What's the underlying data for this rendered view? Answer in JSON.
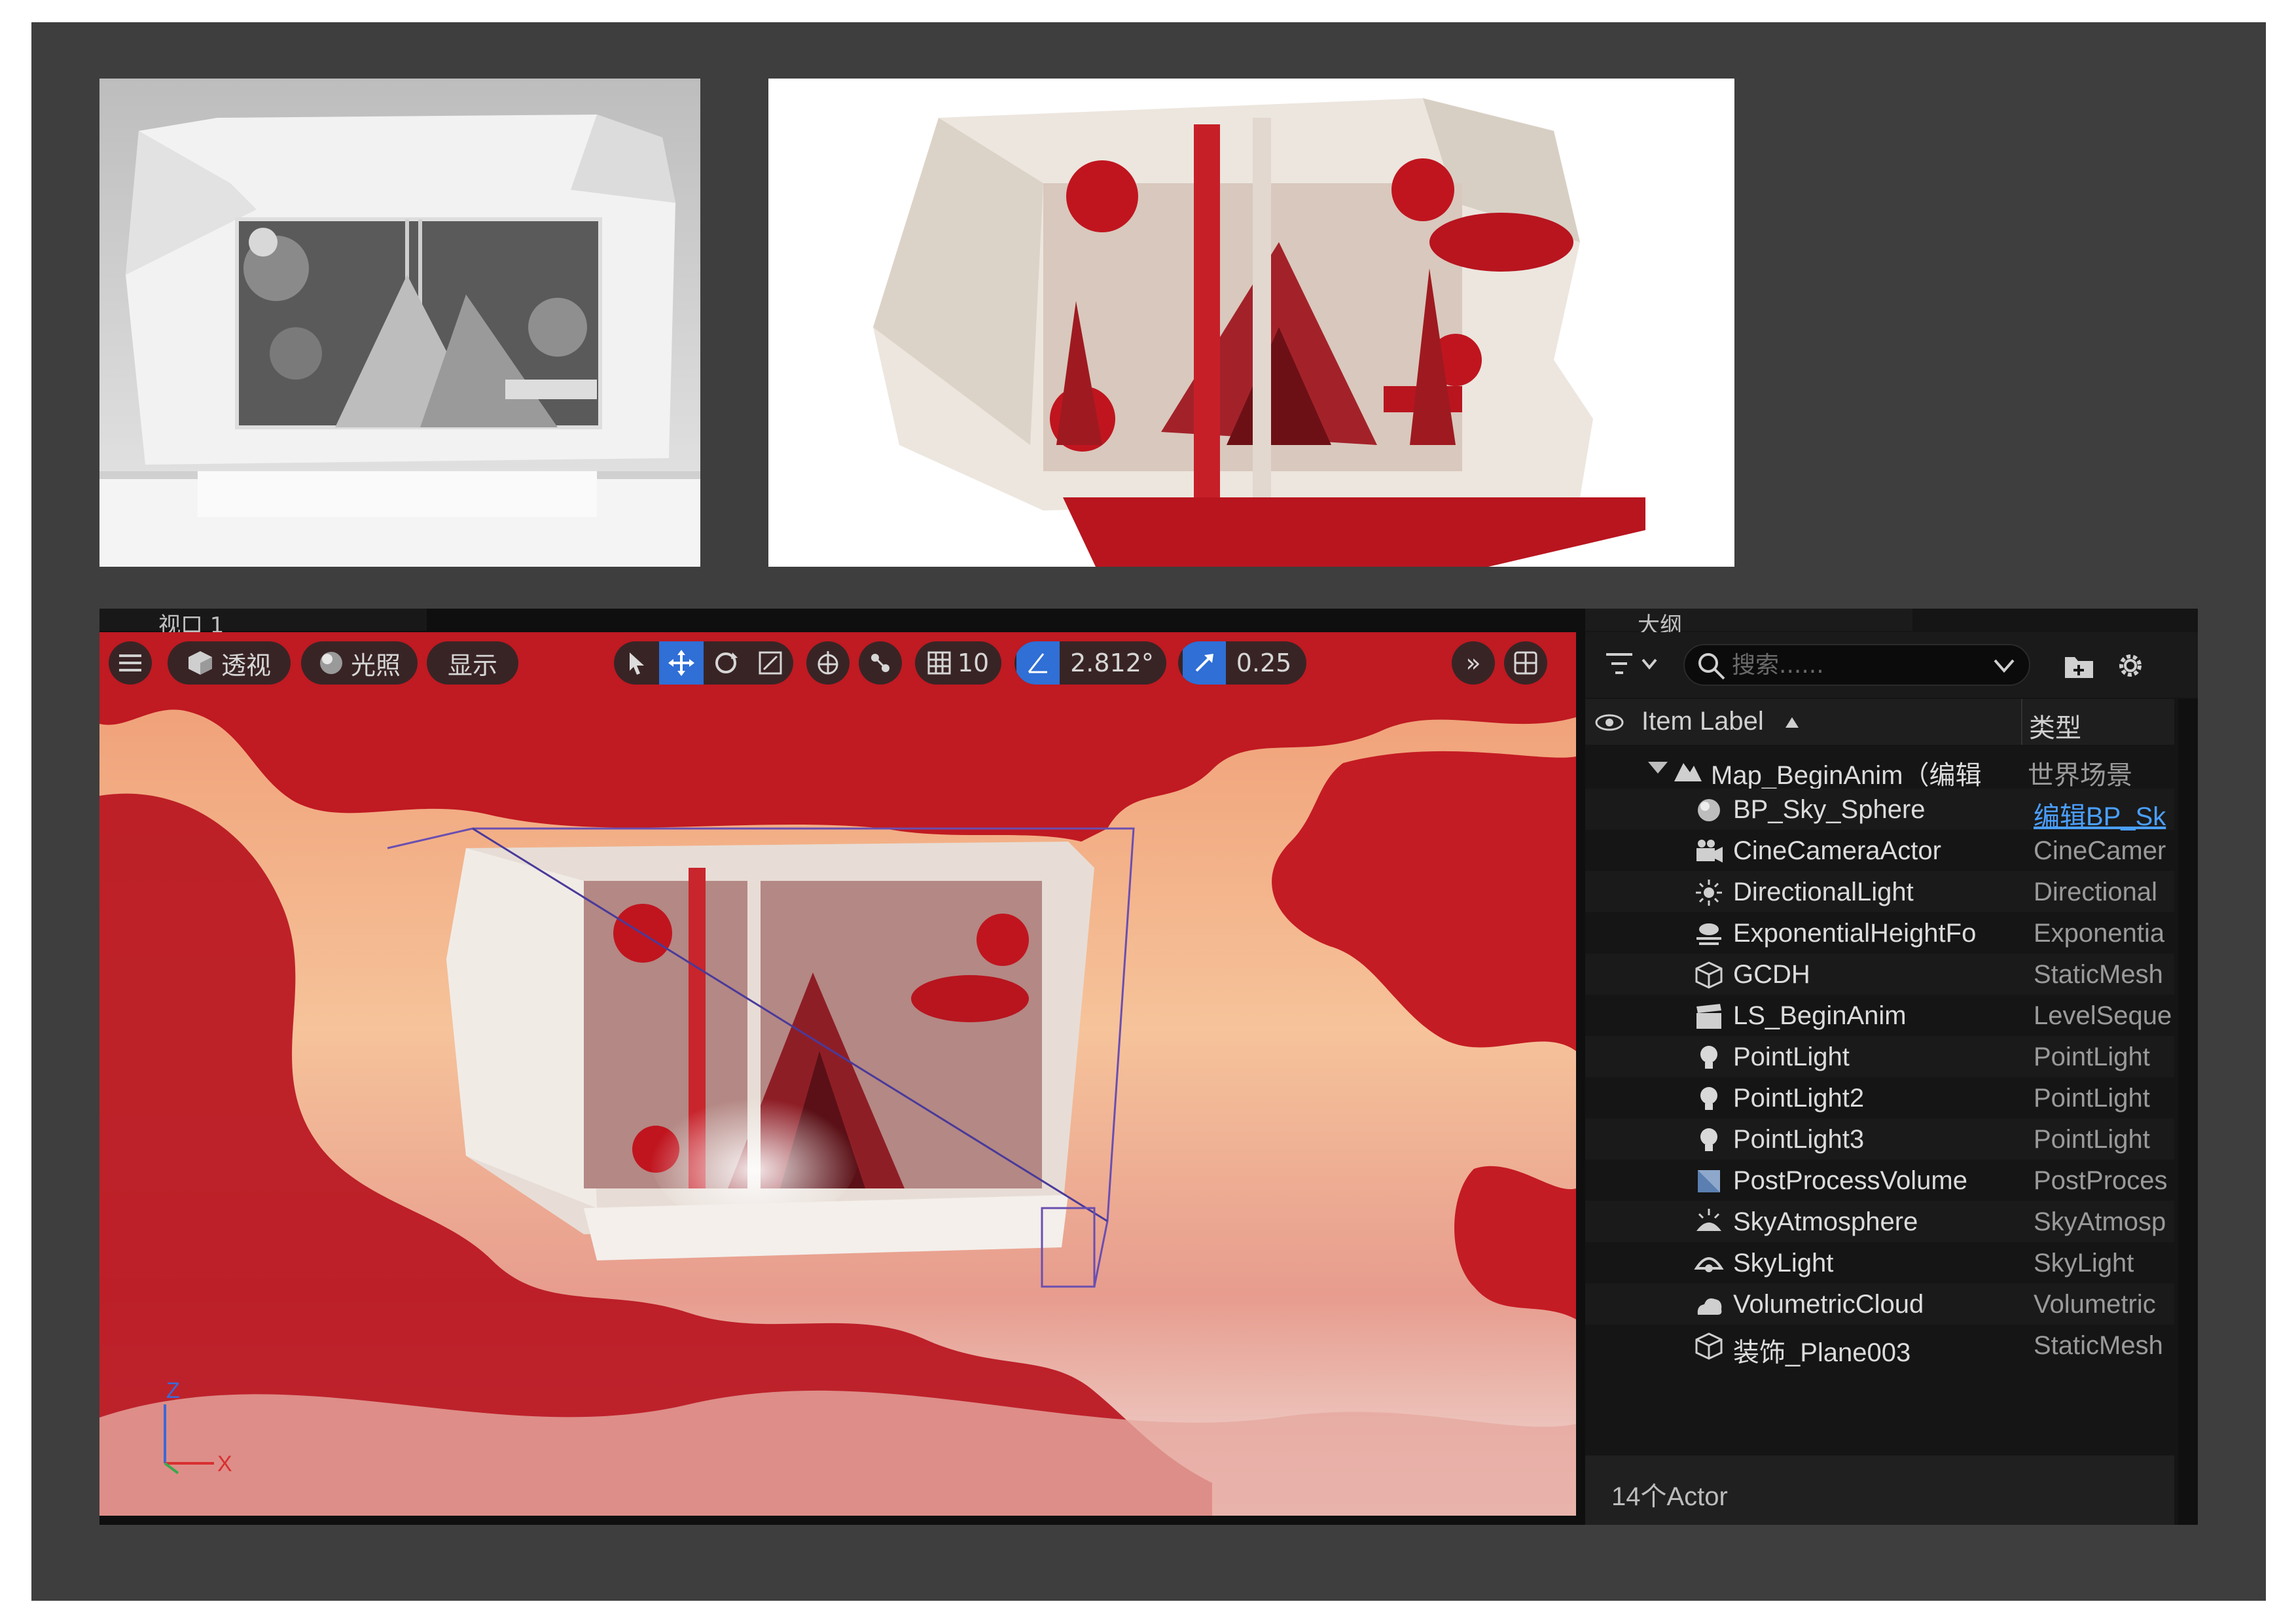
{
  "viewport": {
    "tab_label": "视口 1",
    "toolbar": {
      "perspective_label": "透视",
      "lighting_label": "光照",
      "show_label": "显示",
      "grid_snap_value": "10",
      "rotation_snap_value": "2.812°",
      "scale_snap_value": "0.25"
    },
    "axis": {
      "z_label": "Z",
      "x_label": "X"
    }
  },
  "outliner": {
    "tab_label": "大纲",
    "search": {
      "placeholder": "搜索......"
    },
    "columns": {
      "label": "Item Label",
      "type": "类型"
    },
    "root": {
      "label": "Map_BeginAnim（编辑",
      "type": "世界场景"
    },
    "items": [
      {
        "label": "BP_Sky_Sphere",
        "type": "编辑BP_Sk",
        "icon": "sphere-icon",
        "link": true
      },
      {
        "label": "CineCameraActor",
        "type": "CineCamer",
        "icon": "camera-icon"
      },
      {
        "label": "DirectionalLight",
        "type": "Directional",
        "icon": "sun-icon"
      },
      {
        "label": "ExponentialHeightFo",
        "type": "Exponentia",
        "icon": "fog-icon"
      },
      {
        "label": "GCDH",
        "type": "StaticMesh",
        "icon": "cube-icon"
      },
      {
        "label": "LS_BeginAnim",
        "type": "LevelSeque",
        "icon": "clapper-icon"
      },
      {
        "label": "PointLight",
        "type": "PointLight",
        "icon": "bulb-icon"
      },
      {
        "label": "PointLight2",
        "type": "PointLight",
        "icon": "bulb-icon"
      },
      {
        "label": "PointLight3",
        "type": "PointLight",
        "icon": "bulb-icon"
      },
      {
        "label": "PostProcessVolume",
        "type": "PostProces",
        "icon": "volume-icon"
      },
      {
        "label": "SkyAtmosphere",
        "type": "SkyAtmosp",
        "icon": "atmosphere-icon"
      },
      {
        "label": "SkyLight",
        "type": "SkyLight",
        "icon": "skylight-icon"
      },
      {
        "label": "VolumetricCloud",
        "type": "Volumetric",
        "icon": "cloud-icon"
      },
      {
        "label": "装饰_Plane003",
        "type": "StaticMesh",
        "icon": "cube-icon"
      }
    ],
    "status": "14个Actor"
  },
  "colors": {
    "accent_blue": "#2f6fd6",
    "paper_red": "#b8151f",
    "background_peach": "#f2b48a",
    "board_grey": "#3e3e3e"
  }
}
